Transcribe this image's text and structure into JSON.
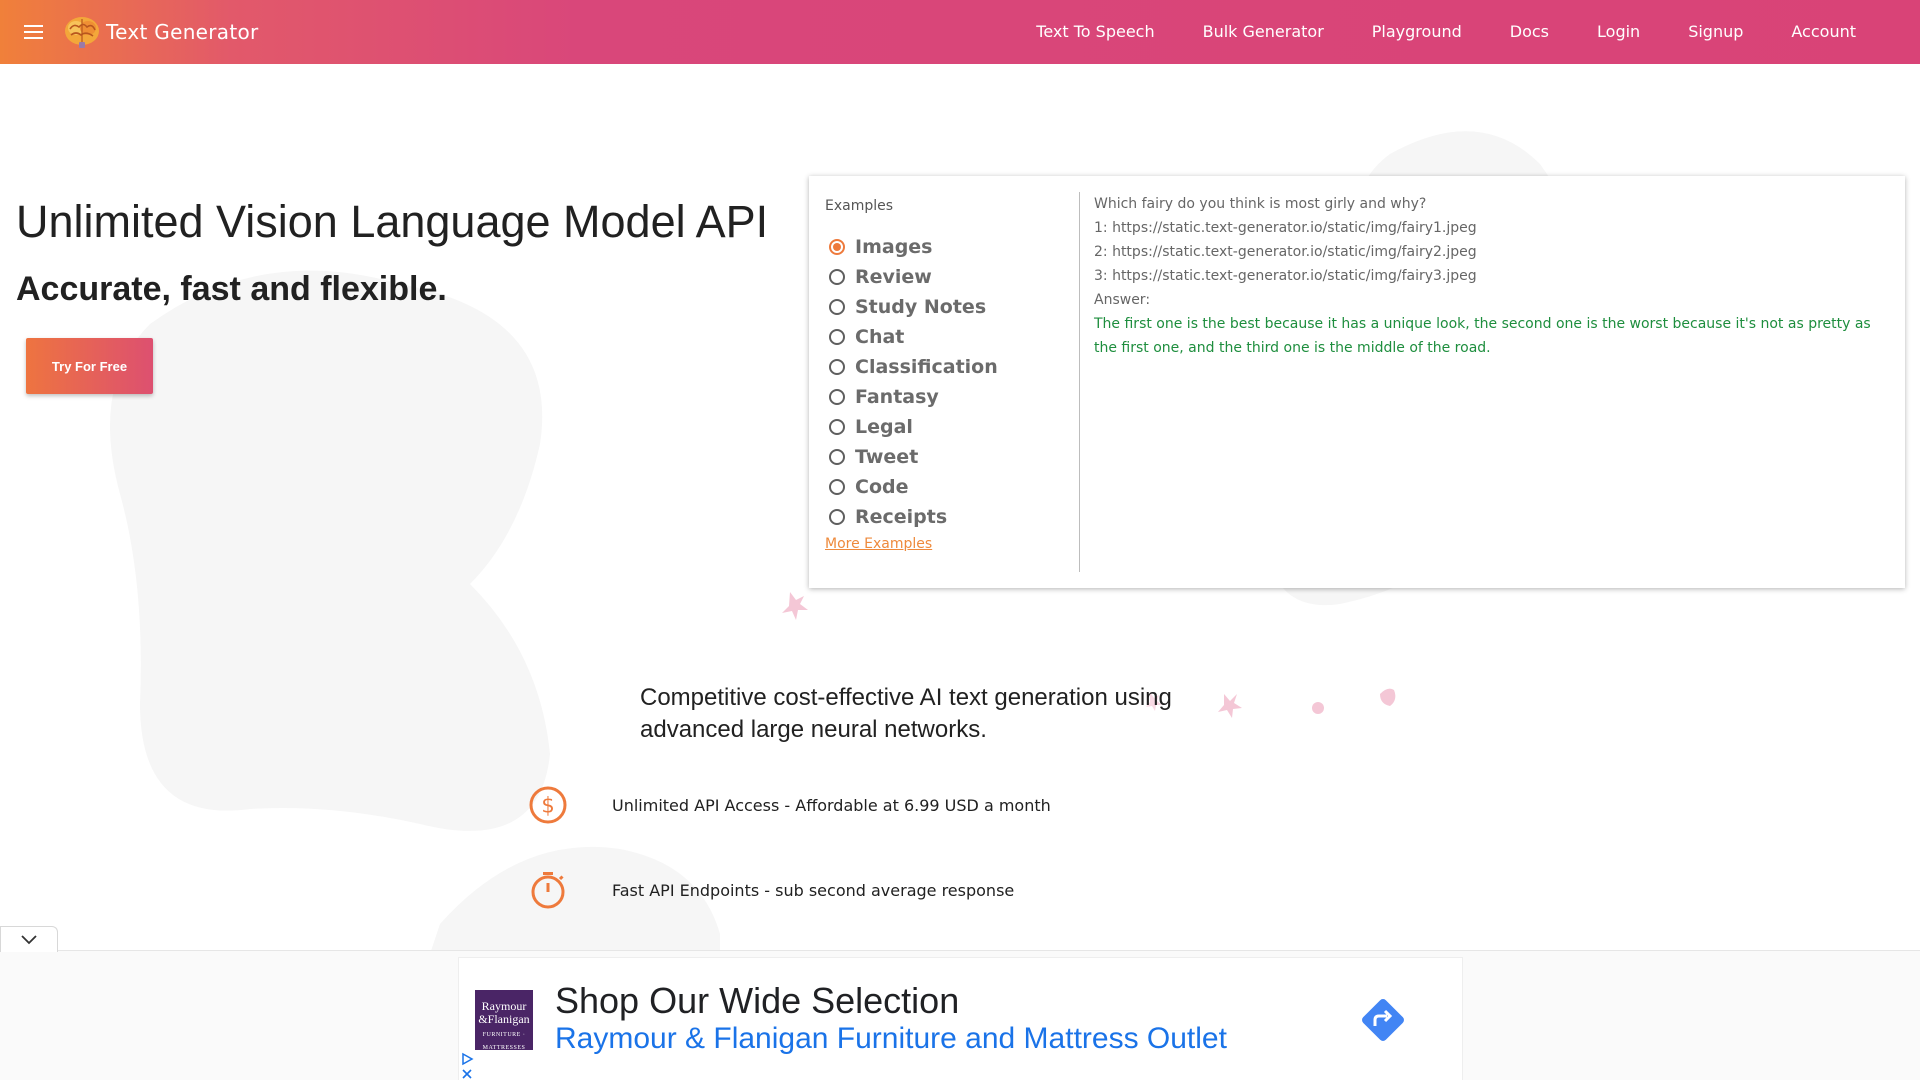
{
  "navbar": {
    "brand": "Text Generator",
    "links": [
      "Text To Speech",
      "Bulk Generator",
      "Playground",
      "Docs",
      "Login",
      "Signup",
      "Account"
    ]
  },
  "hero": {
    "title": "Unlimited Vision Language Model API",
    "subtitle": "Accurate, fast and flexible.",
    "cta_label": "Try For Free"
  },
  "examples": {
    "heading": "Examples",
    "items": [
      "Images",
      "Review",
      "Study Notes",
      "Chat",
      "Classification",
      "Fantasy",
      "Legal",
      "Tweet",
      "Code",
      "Receipts"
    ],
    "selected": "Images",
    "more_label": "More Examples",
    "prompt_lines": [
      "Which fairy do you think is most girly and why?",
      "1: https://static.text-generator.io/static/img/fairy1.jpeg",
      "2: https://static.text-generator.io/static/img/fairy2.jpeg",
      "3: https://static.text-generator.io/static/img/fairy3.jpeg",
      "Answer:"
    ],
    "answer": "The first one is the best because it has a unique look, the second one is the worst because it's not as pretty as the first one, and the third one is the middle of the road."
  },
  "features": {
    "intro": "Competitive cost-effective AI text generation using advanced large neural networks.",
    "items": [
      {
        "icon": "dollar-icon",
        "text": "Unlimited API Access - Affordable at 6.99 USD a month"
      },
      {
        "icon": "timer-icon",
        "text": "Fast API Endpoints - sub second average response"
      }
    ]
  },
  "ad": {
    "logo_line1": "Raymour",
    "logo_line2": "&Flanigan",
    "logo_line3": "FURNITURE · MATTRESSES",
    "headline": "Shop Our Wide Selection",
    "subline": "Raymour & Flanigan Furniture and Mattress Outlet"
  },
  "colors": {
    "accent_orange": "#ee7a3c",
    "accent_pink": "#d9477a",
    "answer_green": "#1e8e3e",
    "ad_link_blue": "#1a73e8"
  }
}
